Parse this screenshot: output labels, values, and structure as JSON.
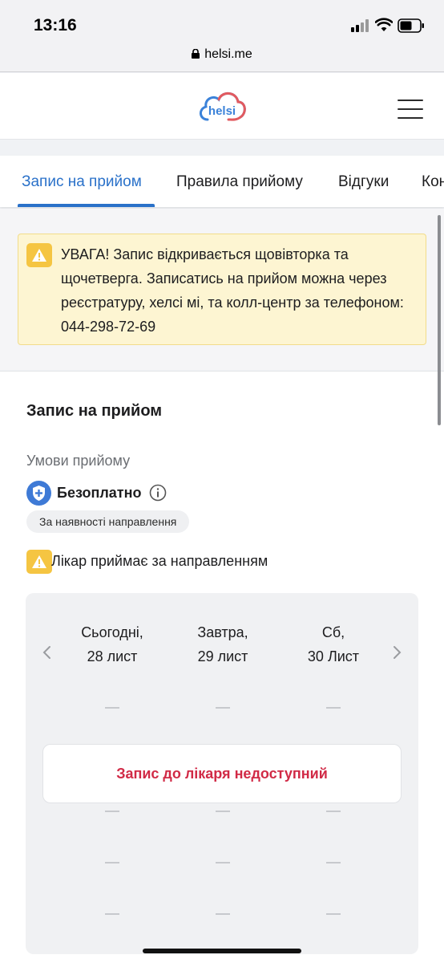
{
  "status_bar": {
    "time": "13:16"
  },
  "url_bar": {
    "domain": "helsi.me"
  },
  "header": {
    "logo_text": "helsi"
  },
  "tabs": [
    {
      "label": "Запис на прийом",
      "active": true
    },
    {
      "label": "Правила прийому",
      "active": false
    },
    {
      "label": "Відгуки",
      "active": false
    },
    {
      "label": "Кон",
      "active": false
    }
  ],
  "notice": {
    "text": "УВАГА! Запис відкривається щовівторка та щочетверга. Записатись на прийом можна через реєстратуру, хелсі мі, та колл-центр за телефоном: 044-298-72-69"
  },
  "appointment": {
    "title": "Запис на прийом",
    "conditions_label": "Умови прийому",
    "price_label": "Безоплатно",
    "referral_chip": "За наявності направлення",
    "referral_note": "Лікар приймає за направленням"
  },
  "schedule": {
    "days": [
      {
        "line1": "Сьогодні,",
        "line2": "28 лист"
      },
      {
        "line1": "Завтра,",
        "line2": "29 лист"
      },
      {
        "line1": "Сб,",
        "line2": "30 Лист"
      }
    ],
    "slot_placeholder": "—",
    "unavailable_text": "Запис до лікаря недоступний"
  },
  "colors": {
    "accent": "#2a71c9",
    "warning": "#f5c542",
    "danger": "#d12a46",
    "notice_bg": "#fdf5d2"
  }
}
